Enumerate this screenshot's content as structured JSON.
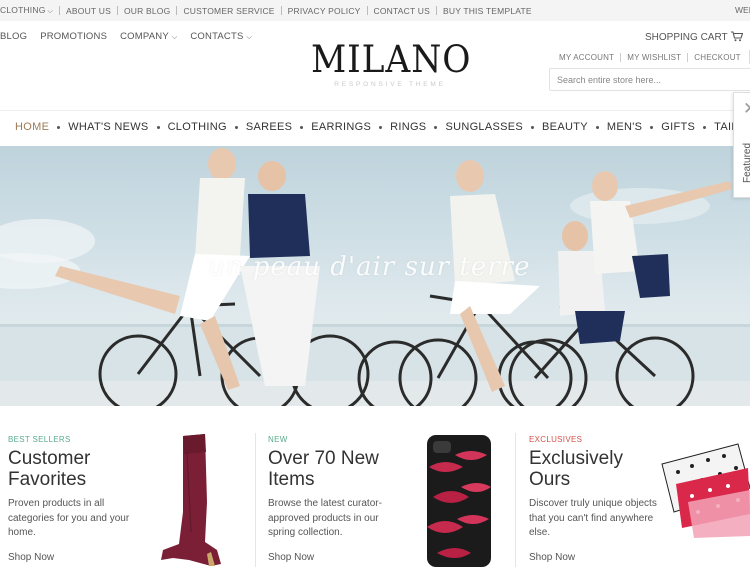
{
  "topbar": {
    "links": [
      "CLOTHING",
      "ABOUT US",
      "OUR BLOG",
      "CUSTOMER SERVICE",
      "PRIVACY POLICY",
      "CONTACT US",
      "BUY THIS TEMPLATE"
    ],
    "welcome": "WEL"
  },
  "header": {
    "links": [
      "BLOG",
      "PROMOTIONS",
      "COMPANY",
      "CONTACTS"
    ],
    "logo": {
      "name": "MILANO",
      "tagline": "RESPONSIVE THEME"
    },
    "cart_label": "SHOPPING CART",
    "account_links": [
      "MY ACCOUNT",
      "MY WISHLIST",
      "CHECKOUT"
    ],
    "search_placeholder": "Search entire store here..."
  },
  "nav": {
    "items": [
      "HOME",
      "WHAT'S NEWS",
      "CLOTHING",
      "SAREES",
      "EARRINGS",
      "RINGS",
      "SUNGLASSES",
      "BEAUTY",
      "MEN'S",
      "GIFTS",
      "TAILORED S"
    ],
    "active_index": 0,
    "active_color": "#9b7c58"
  },
  "side_panel": {
    "label": "Featured"
  },
  "hero": {
    "script_text": "un peau d'air sur terre"
  },
  "promos": [
    {
      "label": "BEST SELLERS",
      "label_color": "#5aab8d",
      "title": "Customer Favorites",
      "description": "Proven products in all categories for you and your home.",
      "link": "Shop Now"
    },
    {
      "label": "NEW",
      "label_color": "#5aab8d",
      "title": "Over 70 New Items",
      "description": "Browse the latest curator-approved products in our spring collection.",
      "link": "Shop Now"
    },
    {
      "label": "EXCLUSIVES",
      "label_color": "#d5524a",
      "title": "Exclusively Ours",
      "description": "Discover truly unique objects that you can't find anywhere else.",
      "link": "Shop Now"
    }
  ],
  "icons": {
    "cart": "cart-icon",
    "caret": "chevron-down-icon",
    "close": "close-icon"
  }
}
